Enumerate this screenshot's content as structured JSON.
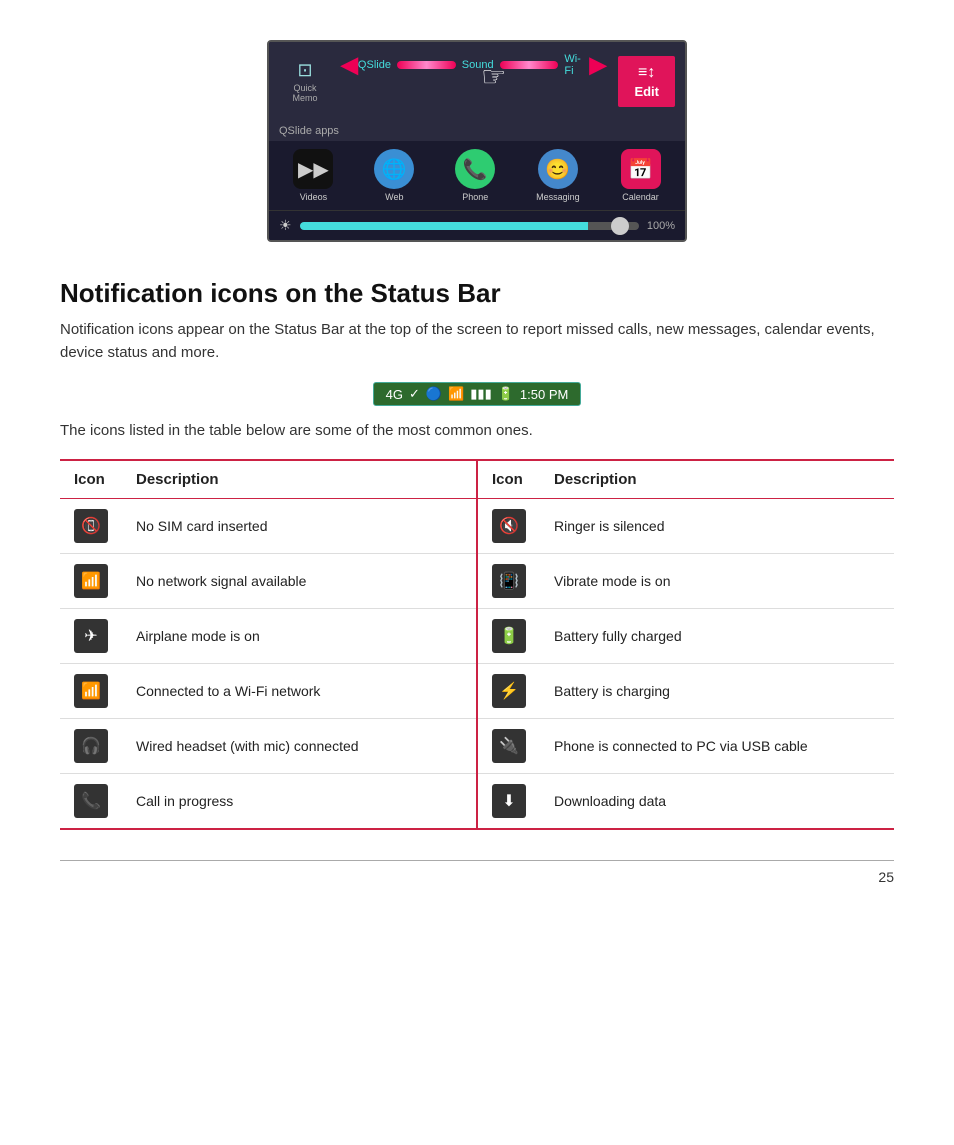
{
  "phone_ui": {
    "quick_items": [
      {
        "icon": "📋",
        "label": "Quick\nMemo"
      },
      {
        "icon": "⊞",
        "label": "QSlide",
        "cyan": true
      },
      {
        "icon": "🔊",
        "label": "Sound",
        "cyan": true
      },
      {
        "icon": "📶",
        "label": "Wi-Fi",
        "cyan": true
      }
    ],
    "edit_label": "Edit",
    "qslide_section": "QSlide apps",
    "apps": [
      {
        "label": "Videos",
        "emoji": "▶"
      },
      {
        "label": "Web",
        "emoji": "🌐"
      },
      {
        "label": "Phone",
        "emoji": "📞"
      },
      {
        "label": "Messaging",
        "emoji": "💬"
      },
      {
        "label": "Calendar",
        "emoji": "📅"
      }
    ],
    "brightness_pct": "100%"
  },
  "section": {
    "title": "Notification icons on the Status Bar",
    "description": "Notification icons appear on the Status Bar at the top of the screen to report missed calls, new messages, calendar events, device status and more.",
    "icons_note": "The icons listed in the table below are some of the most common ones.",
    "status_bar_time": "1:50 PM"
  },
  "table": {
    "col1_icon_header": "Icon",
    "col1_desc_header": "Description",
    "col2_icon_header": "Icon",
    "col2_desc_header": "Description",
    "left_rows": [
      {
        "icon": "📵",
        "desc": "No SIM card inserted"
      },
      {
        "icon": "📶",
        "desc": "No network signal available"
      },
      {
        "icon": "✈",
        "desc": "Airplane mode is on"
      },
      {
        "icon": "📶",
        "desc": "Connected to a Wi-Fi network"
      },
      {
        "icon": "🎧",
        "desc": "Wired headset (with mic) connected"
      },
      {
        "icon": "📞",
        "desc": "Call in progress"
      }
    ],
    "right_rows": [
      {
        "icon": "🔇",
        "desc": "Ringer is silenced"
      },
      {
        "icon": "📳",
        "desc": "Vibrate mode is on"
      },
      {
        "icon": "🔋",
        "desc": "Battery fully charged"
      },
      {
        "icon": "⚡",
        "desc": "Battery is charging"
      },
      {
        "icon": "🔌",
        "desc": "Phone is connected to PC via USB cable"
      },
      {
        "icon": "⬇",
        "desc": "Downloading data"
      }
    ]
  },
  "page_number": "25"
}
